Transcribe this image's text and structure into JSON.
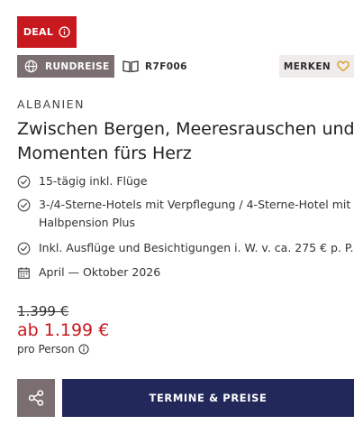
{
  "badge": {
    "label": "DEAL"
  },
  "tags": {
    "type_label": "RUNDREISE",
    "code": "R7F006",
    "merken_label": "MERKEN"
  },
  "offer": {
    "country": "ALBANIEN",
    "title": "Zwischen Bergen, Meeresrauschen und Momenten fürs Herz",
    "features": [
      "15-tägig inkl. Flüge",
      "3-/4-Sterne-Hotels mit Verpflegung / 4-Sterne-Hotel mit Halbpension Plus",
      "Inkl. Ausflüge und Besichtigungen i. W. v. ca. 275 € p. P."
    ],
    "period": "April — Oktober 2026"
  },
  "price": {
    "old": "1.399 €",
    "current": "ab 1.199 €",
    "per_person": "pro Person"
  },
  "actions": {
    "cta_label": "TERMINE & PREISE"
  },
  "colors": {
    "accent_red": "#c8191f",
    "tag_gray": "#7a6e70",
    "cta_navy": "#23285a",
    "merken_bg": "#f0ecec"
  }
}
